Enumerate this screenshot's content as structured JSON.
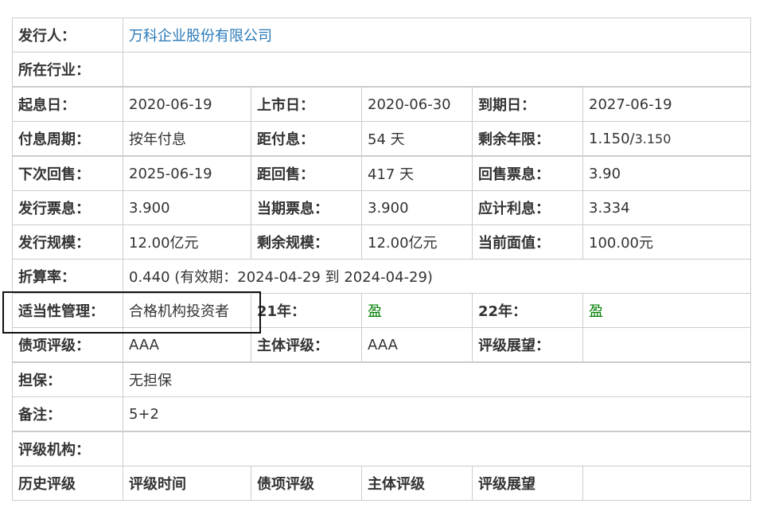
{
  "issuer_label": "发行人：",
  "issuer": "万科企业股份有限公司",
  "industry_label": "所在行业：",
  "rows": [
    [
      "起息日：",
      "2020-06-19",
      "上市日：",
      "2020-06-30",
      "到期日：",
      "2027-06-19"
    ],
    [
      "付息周期：",
      "按年付息",
      "距付息：",
      "54 天",
      "剩余年限：",
      "1.150/"
    ],
    [
      "下次回售：",
      "2025-06-19",
      "距回售：",
      "417 天",
      "回售票息：",
      "3.90"
    ],
    [
      "发行票息：",
      "3.900",
      "当期票息：",
      "3.900",
      "应计利息：",
      "3.334"
    ],
    [
      "发行规模：",
      "12.00亿元",
      "剩余规模：",
      "12.00亿元",
      "当前面值：",
      "100.00元"
    ]
  ],
  "remaining_years_total": "3.150",
  "conversion_label": "折算率：",
  "conversion": "0.440 (有效期：2024-04-29 到 2024-04-29)",
  "suitability_label": "适当性管理：",
  "suitability": "合格机构投资者",
  "y21_label": "21年：",
  "y21": "盈",
  "y22_label": "22年：",
  "y22": "盈",
  "bond_rating_label": "债项评级：",
  "bond_rating": "AAA",
  "issuer_rating_label": "主体评级：",
  "issuer_rating": "AAA",
  "outlook_label": "评级展望：",
  "guarantee_label": "担保：",
  "guarantee": "无担保",
  "remark_label": "备注：",
  "remark": "5+2",
  "agency_label": "评级机构：",
  "history_headers": [
    "历史评级",
    "评级时间",
    "债项评级",
    "主体评级",
    "评级展望"
  ]
}
